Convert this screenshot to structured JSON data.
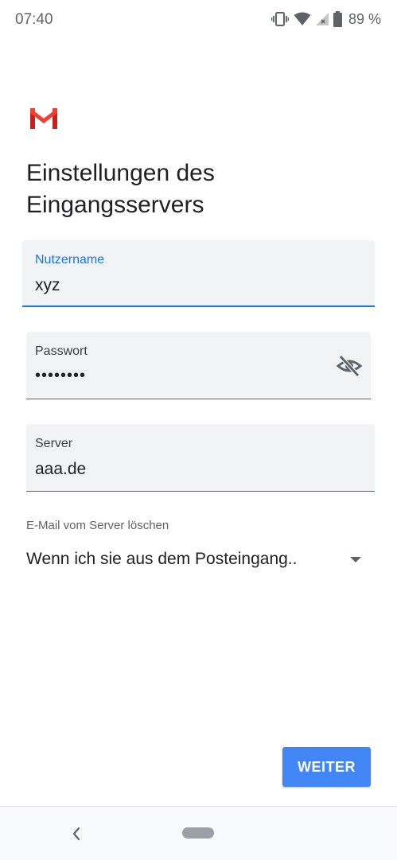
{
  "status_bar": {
    "time": "07:40",
    "battery_percent": "89 %",
    "icons": [
      "vibrate-icon",
      "wifi-icon",
      "signal-icon",
      "battery-icon"
    ]
  },
  "header": {
    "logo": "gmail-logo",
    "title_line1": "Einstellungen des",
    "title_line2": "Eingangsservers"
  },
  "form": {
    "username": {
      "label": "Nutzername",
      "value": "xyz"
    },
    "password": {
      "label": "Passwort",
      "value": "••••••••",
      "toggle_icon": "visibility-off-icon"
    },
    "server": {
      "label": "Server",
      "value": "aaa.de"
    },
    "delete_from_server": {
      "label": "E-Mail vom Server löschen",
      "selected": "Wenn ich sie aus dem Posteingang.."
    }
  },
  "actions": {
    "next_label": "WEITER"
  },
  "colors": {
    "accent": "#1a73e8",
    "button": "#4285f4",
    "gmail_red": "#d93025"
  },
  "navigation": {
    "icons": [
      "back-icon",
      "home-pill"
    ]
  }
}
